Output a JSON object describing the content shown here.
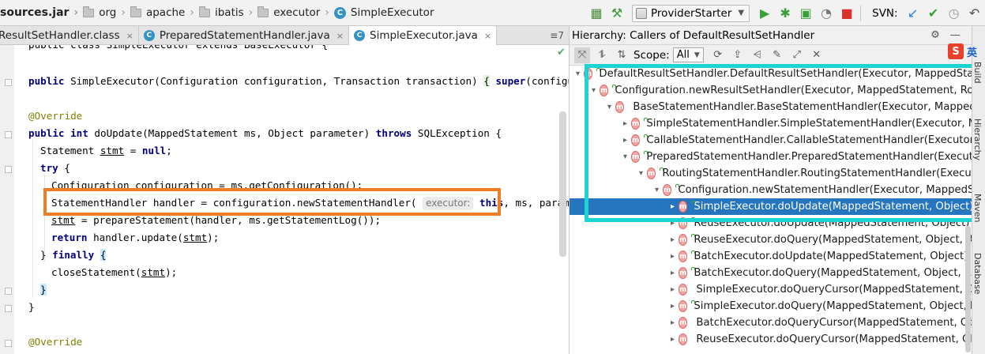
{
  "breadcrumb": [
    {
      "label": "sources.jar",
      "icon": "none"
    },
    {
      "label": "org",
      "icon": "folder-icon"
    },
    {
      "label": "apache",
      "icon": "folder-icon"
    },
    {
      "label": "ibatis",
      "icon": "folder-icon"
    },
    {
      "label": "executor",
      "icon": "folder-icon"
    },
    {
      "label": "SimpleExecutor",
      "icon": "class-icon"
    }
  ],
  "toolbar": {
    "run_config": "ProviderStarter",
    "svn_label": "SVN:"
  },
  "tabs": [
    {
      "label": "ResultSetHandler.class",
      "active": false,
      "close": "×"
    },
    {
      "label": "PreparedStatementHandler.java",
      "active": false,
      "close": "×"
    },
    {
      "label": "SimpleExecutor.java",
      "active": true,
      "close": "×"
    }
  ],
  "tab_overflow": "≡7",
  "code": {
    "l0": "public class SimpleExecutor extends BaseExecutor {",
    "l1_kw": "public",
    "l1_rest": " SimpleExecutor(Configuration configuration, Transaction transaction) ",
    "l1_brace": "{",
    "l1_super": "super",
    "l1_tail": "(configuration,",
    "l2": "@Override",
    "l3_kw1": "public",
    "l3_kw2": "int",
    "l3_mid": " doUpdate(MappedStatement ms, Object parameter) ",
    "l3_kw3": "throws",
    "l3_tail": " SQLException {",
    "l4_a": "Statement ",
    "l4_var": "stmt",
    "l4_b": " = ",
    "l4_null": "null",
    "l4_c": ";",
    "l5_kw": "try",
    "l5_b": " {",
    "l6": "Configuration configuration = ms.getConfiguration();",
    "l7_a": "StatementHandler handler = configuration.newStatementHandler(",
    "l7_hint": "executor:",
    "l7_this": "this",
    "l7_b": ", ms, parameter, ro",
    "l8_var": "stmt",
    "l8_b": " = prepareStatement(handler, ms.getStatementLog());",
    "l9_kw": "return",
    "l9_a": " handler.update(",
    "l9_var": "stmt",
    "l9_b": ");",
    "l10_a": "} ",
    "l10_kw": "finally",
    "l10_brace": "{",
    "l11_a": "closeStatement(",
    "l11_var": "stmt",
    "l11_b": ");",
    "l12": "}",
    "l13": "}",
    "l14": "@Override"
  },
  "hierarchy": {
    "title": "Hierarchy:  Callers of DefaultResultSetHandler",
    "scope_label": "Scope:",
    "scope_value": "All",
    "nodes": [
      {
        "indent": 0,
        "arrow": "▾",
        "vis": "pub",
        "text": "DefaultResultSetHandler.DefaultResultSetHandler(Executor, MappedStatement",
        "pkg": "",
        "selected": false
      },
      {
        "indent": 1,
        "arrow": "▾",
        "vis": "pub",
        "text": "Configuration.newResultSetHandler(Executor, MappedStatement, RowBoun",
        "pkg": "",
        "selected": false
      },
      {
        "indent": 2,
        "arrow": "▾",
        "vis": "prot",
        "text": "BaseStatementHandler.BaseStatementHandler(Executor, MappedStatem",
        "pkg": "",
        "selected": false
      },
      {
        "indent": 3,
        "arrow": "▸",
        "vis": "pub",
        "text": "SimpleStatementHandler.SimpleStatementHandler(Executor, Mappe",
        "pkg": "",
        "selected": false
      },
      {
        "indent": 3,
        "arrow": "▸",
        "vis": "pub",
        "text": "CallableStatementHandler.CallableStatementHandler(Executor, Map",
        "pkg": "",
        "selected": false
      },
      {
        "indent": 3,
        "arrow": "▾",
        "vis": "pub",
        "text": "PreparedStatementHandler.PreparedStatementHandler(Executor, M",
        "pkg": "",
        "selected": false
      },
      {
        "indent": 4,
        "arrow": "▾",
        "vis": "pub",
        "text": "RoutingStatementHandler.RoutingStatementHandler(Executor, M",
        "pkg": "",
        "selected": false
      },
      {
        "indent": 5,
        "arrow": "▾",
        "vis": "pub",
        "text": "Configuration.newStatementHandler(Executor, MappedStatem",
        "pkg": "",
        "selected": false
      },
      {
        "indent": 6,
        "arrow": "▸",
        "vis": "pub",
        "text": "SimpleExecutor.doUpdate(MappedStatement, Object)",
        "pkg": "(o",
        "selected": true
      },
      {
        "indent": 6,
        "arrow": "▸",
        "vis": "pub",
        "text": "ReuseExecutor.doUpdate(MappedStatement, Object)",
        "pkg": "",
        "selected": false
      },
      {
        "indent": 6,
        "arrow": "▸",
        "vis": "pub",
        "text": "ReuseExecutor.doQuery(MappedStatement, Object, RowBo",
        "pkg": "",
        "selected": false
      },
      {
        "indent": 6,
        "arrow": "▸",
        "vis": "pub",
        "text": "BatchExecutor.doUpdate(MappedStatement, Object)",
        "pkg": "(org",
        "selected": false
      },
      {
        "indent": 6,
        "arrow": "▸",
        "vis": "pub",
        "text": "BatchExecutor.doQuery(MappedStatement, Object, RowBo",
        "pkg": "",
        "selected": false
      },
      {
        "indent": 6,
        "arrow": "▸",
        "vis": "prot",
        "text": "SimpleExecutor.doQueryCursor(MappedStatement, Objec",
        "pkg": "",
        "selected": false
      },
      {
        "indent": 6,
        "arrow": "▸",
        "vis": "pub",
        "text": "SimpleExecutor.doQuery(MappedStatement, Object, Row",
        "pkg": "",
        "selected": false
      },
      {
        "indent": 6,
        "arrow": "▸",
        "vis": "prot",
        "text": "BatchExecutor.doQueryCursor(MappedStatement, Object",
        "pkg": "",
        "selected": false
      },
      {
        "indent": 6,
        "arrow": "▸",
        "vis": "prot",
        "text": "ReuseExecutor.doQueryCursor(MappedStatement, Object",
        "pkg": "",
        "selected": false
      }
    ]
  },
  "side": {
    "ime_logo": "S",
    "ime_text": "英",
    "labels": [
      "Build",
      "Hierarchy",
      "Maven",
      "Database"
    ]
  },
  "colors": {
    "highlight_orange": "#ef7d26",
    "highlight_cyan": "#1cd4d4",
    "selection_blue": "#2675bf"
  }
}
